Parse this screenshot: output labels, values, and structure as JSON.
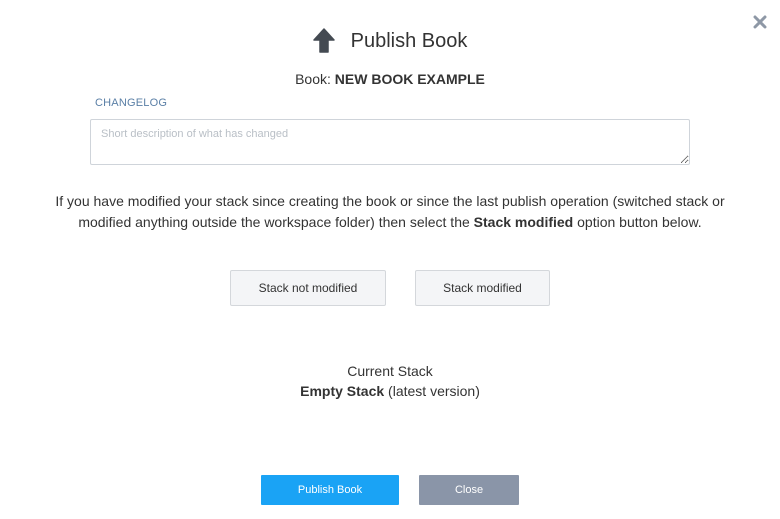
{
  "dialog": {
    "title": "Publish Book",
    "title_icon": "arrow-up-icon",
    "close_icon": "close-icon"
  },
  "book": {
    "label": "Book: ",
    "name": "NEW BOOK EXAMPLE"
  },
  "changelog": {
    "label": "CHANGELOG",
    "placeholder": "Short description of what has changed",
    "value": ""
  },
  "info": {
    "text_before": "If you have modified your stack since creating the book or since the last publish operation (switched stack or modified anything outside the workspace folder) then select the ",
    "emphasis": "Stack modified",
    "text_after": " option button below."
  },
  "options": {
    "not_modified_label": "Stack not modified",
    "modified_label": "Stack modified"
  },
  "current_stack": {
    "heading": "Current Stack",
    "name": "Empty Stack",
    "version": " (latest version)"
  },
  "actions": {
    "publish_label": "Publish Book",
    "close_label": "Close"
  },
  "colors": {
    "primary": "#1aa3f5",
    "secondary": "#8a95a8",
    "label_blue": "#5a7fa6"
  }
}
